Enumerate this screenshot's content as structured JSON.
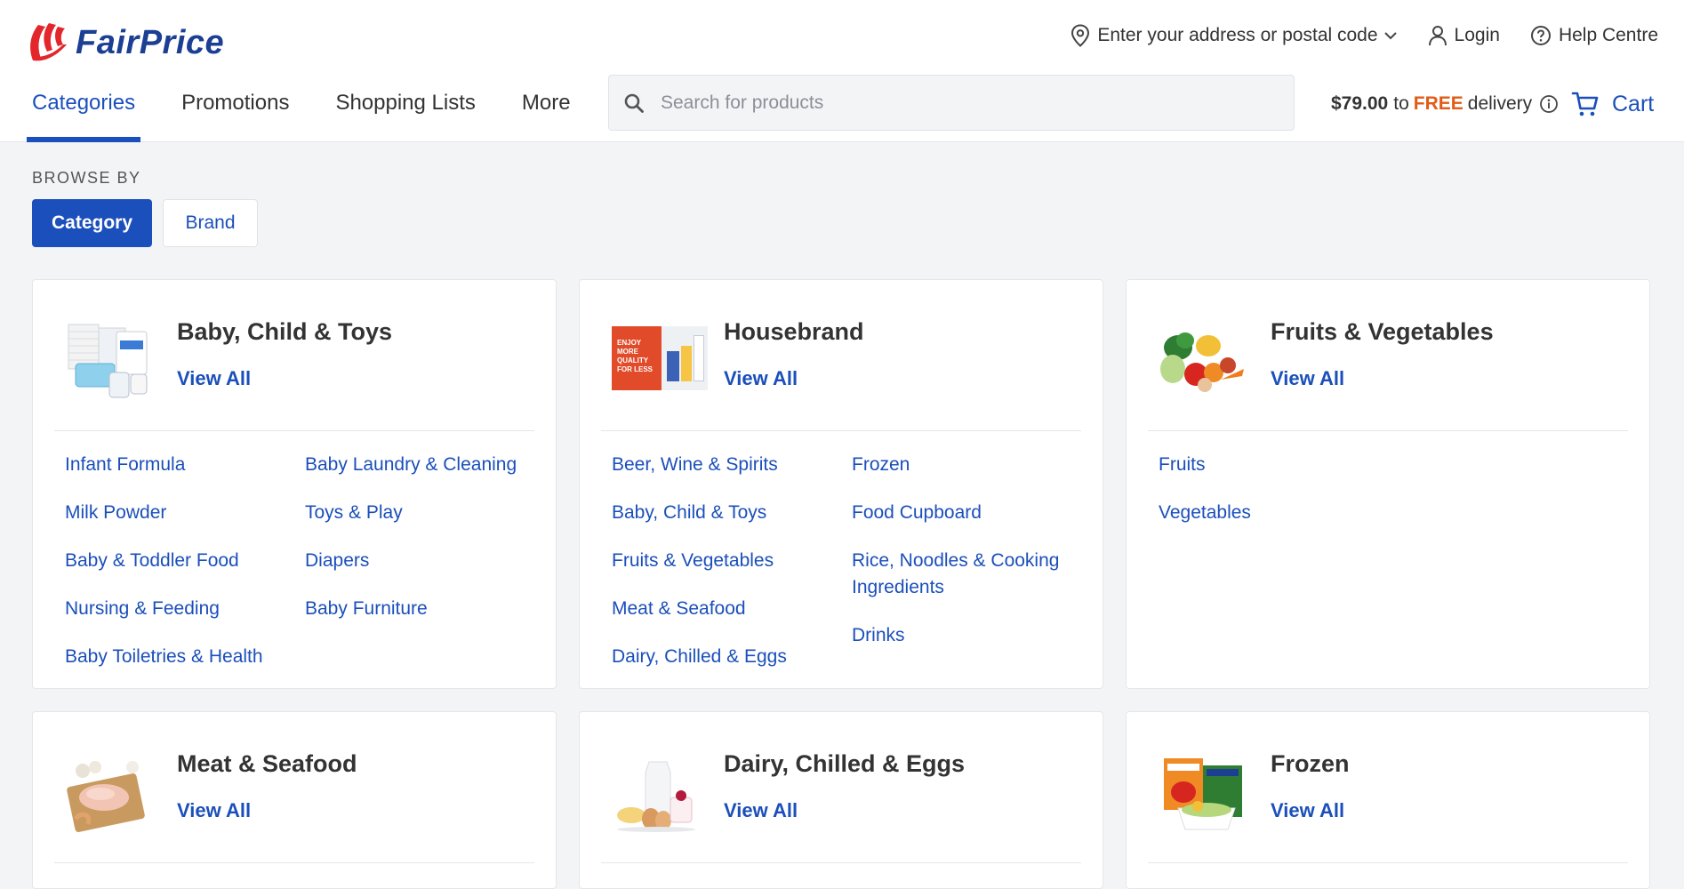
{
  "brand": {
    "name": "FairPrice",
    "primary_color": "#1b4fbb",
    "logo_red": "#e3262b",
    "accent_orange": "#e25b17"
  },
  "header": {
    "address_label": "Enter your address or postal code",
    "login_label": "Login",
    "help_label": "Help Centre",
    "nav_tabs": [
      {
        "label": "Categories",
        "active": true
      },
      {
        "label": "Promotions",
        "active": false
      },
      {
        "label": "Shopping Lists",
        "active": false
      },
      {
        "label": "More",
        "active": false
      }
    ],
    "search_placeholder": "Search for products",
    "delivery": {
      "amount": "$79.00",
      "to": "to",
      "free": "FREE",
      "suffix": "delivery"
    },
    "cart_label": "Cart"
  },
  "browse": {
    "label": "BROWSE BY",
    "options": [
      {
        "label": "Category",
        "active": true
      },
      {
        "label": "Brand",
        "active": false
      }
    ]
  },
  "categories": [
    {
      "title": "Baby, Child & Toys",
      "view_all": "View All",
      "icon": "baby-products-image",
      "col1": [
        "Infant Formula",
        "Milk Powder",
        "Baby & Toddler Food",
        "Nursing & Feeding",
        "Baby Toiletries & Health"
      ],
      "col2": [
        "Baby Laundry & Cleaning",
        "Toys & Play",
        "Diapers",
        "Baby Furniture"
      ]
    },
    {
      "title": "Housebrand",
      "view_all": "View All",
      "icon": "housebrand-banner-image",
      "banner_text": "ENJOY MORE QUALITY FOR LESS",
      "col1": [
        "Beer, Wine & Spirits",
        "Baby, Child & Toys",
        "Fruits & Vegetables",
        "Meat & Seafood",
        "Dairy, Chilled & Eggs"
      ],
      "col2": [
        "Frozen",
        "Food Cupboard",
        "Rice, Noodles & Cooking Ingredients",
        "Drinks"
      ]
    },
    {
      "title": "Fruits & Vegetables",
      "view_all": "View All",
      "icon": "fruits-vegetables-image",
      "col1": [
        "Fruits",
        "Vegetables"
      ],
      "col2": []
    },
    {
      "title": "Meat & Seafood",
      "view_all": "View All",
      "icon": "meat-seafood-image",
      "col1": [],
      "col2": []
    },
    {
      "title": "Dairy, Chilled & Eggs",
      "view_all": "View All",
      "icon": "dairy-eggs-image",
      "col1": [],
      "col2": []
    },
    {
      "title": "Frozen",
      "view_all": "View All",
      "icon": "frozen-food-image",
      "col1": [],
      "col2": []
    }
  ]
}
